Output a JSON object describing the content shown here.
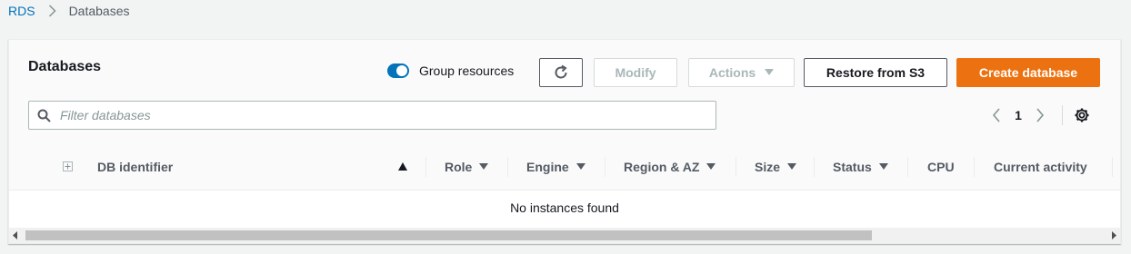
{
  "breadcrumb": {
    "root": "RDS",
    "current": "Databases"
  },
  "panel": {
    "title": "Databases",
    "group_toggle": {
      "label": "Group resources",
      "on": true
    },
    "buttons": {
      "refresh_icon": "refresh-icon",
      "modify": "Modify",
      "actions": "Actions",
      "restore": "Restore from S3",
      "create": "Create database"
    },
    "search": {
      "placeholder": "Filter databases",
      "value": ""
    },
    "pagination": {
      "page": "1"
    }
  },
  "table": {
    "columns": [
      "DB identifier",
      "Role",
      "Engine",
      "Region & AZ",
      "Size",
      "Status",
      "CPU",
      "Current activity"
    ],
    "empty_message": "No instances found"
  },
  "colors": {
    "accent": "#0073bb",
    "primary_button": "#ec7211"
  }
}
